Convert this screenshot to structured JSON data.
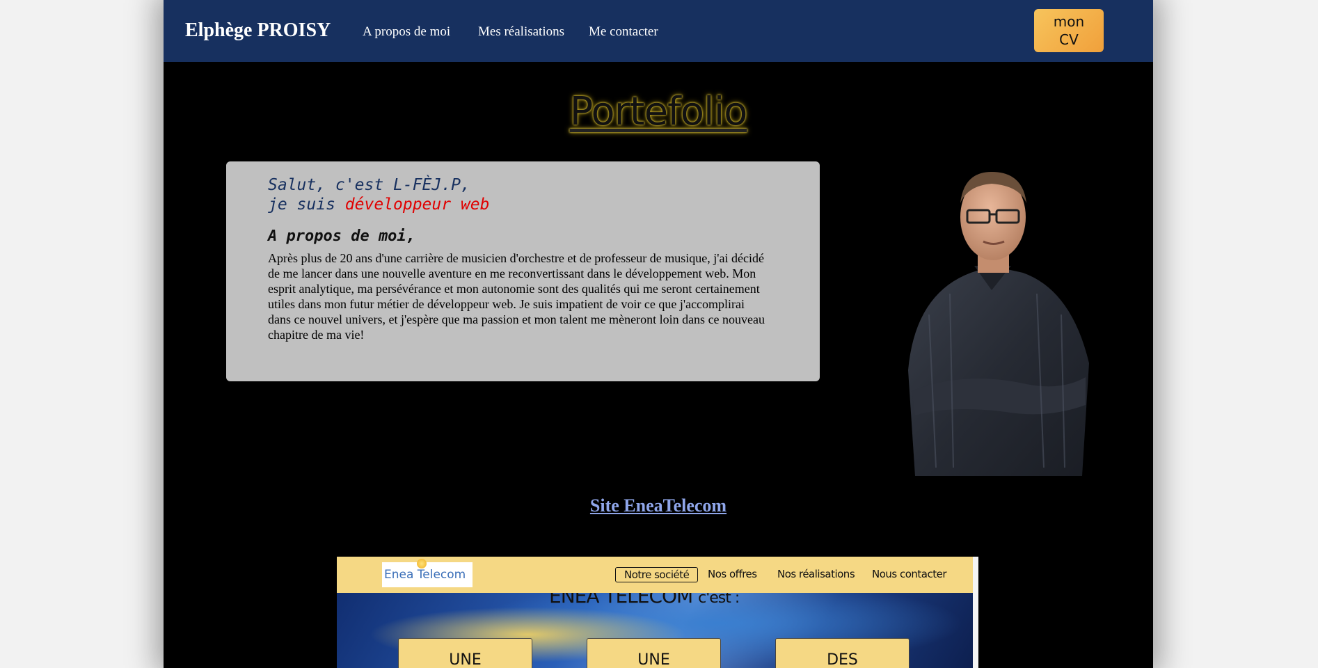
{
  "navbar": {
    "brand": "Elphège PROISY",
    "links": [
      "A propos de moi",
      "Mes réalisations",
      "Me contacter"
    ],
    "cv_button": [
      "mon",
      "CV"
    ]
  },
  "hero": {
    "title": "Portefolio"
  },
  "about": {
    "greeting_line1": "Salut, c'est L-FÈJ.P,",
    "greeting_line2_prefix": "je suis ",
    "greeting_line2_highlight": "développeur web",
    "heading": "A propos de moi,",
    "paragraph": "Après plus de 20 ans d'une carrière de musicien d'orchestre et de professeur de musique, j'ai décidé de me lancer dans une nouvelle aventure en me reconvertissant dans le développement web. Mon esprit analytique, ma persévérance et mon autonomie sont des qualités qui me seront certainement utiles dans mon futur métier de développeur web. Je suis impatient de voir ce que j'accomplirai dans ce nouvel univers, et j'espère que ma passion et mon talent me mèneront loin dans ce nouveau chapitre de ma vie!"
  },
  "projects": {
    "project_link": "Site EneaTelecom",
    "preview": {
      "logo": "Enea Telecom",
      "nav": [
        "Notre société",
        "Nos offres",
        "Nos réalisations",
        "Nous contacter"
      ],
      "heading": "ENEA TELECOM",
      "heading_suffix": "c'est :",
      "cards": [
        "UNE",
        "UNE",
        "DES"
      ]
    }
  },
  "colors": {
    "navbar_bg": "#17305f",
    "cv_button": "#f0a03b",
    "highlight_red": "#e00000",
    "link_blue": "#8fa6ea"
  }
}
